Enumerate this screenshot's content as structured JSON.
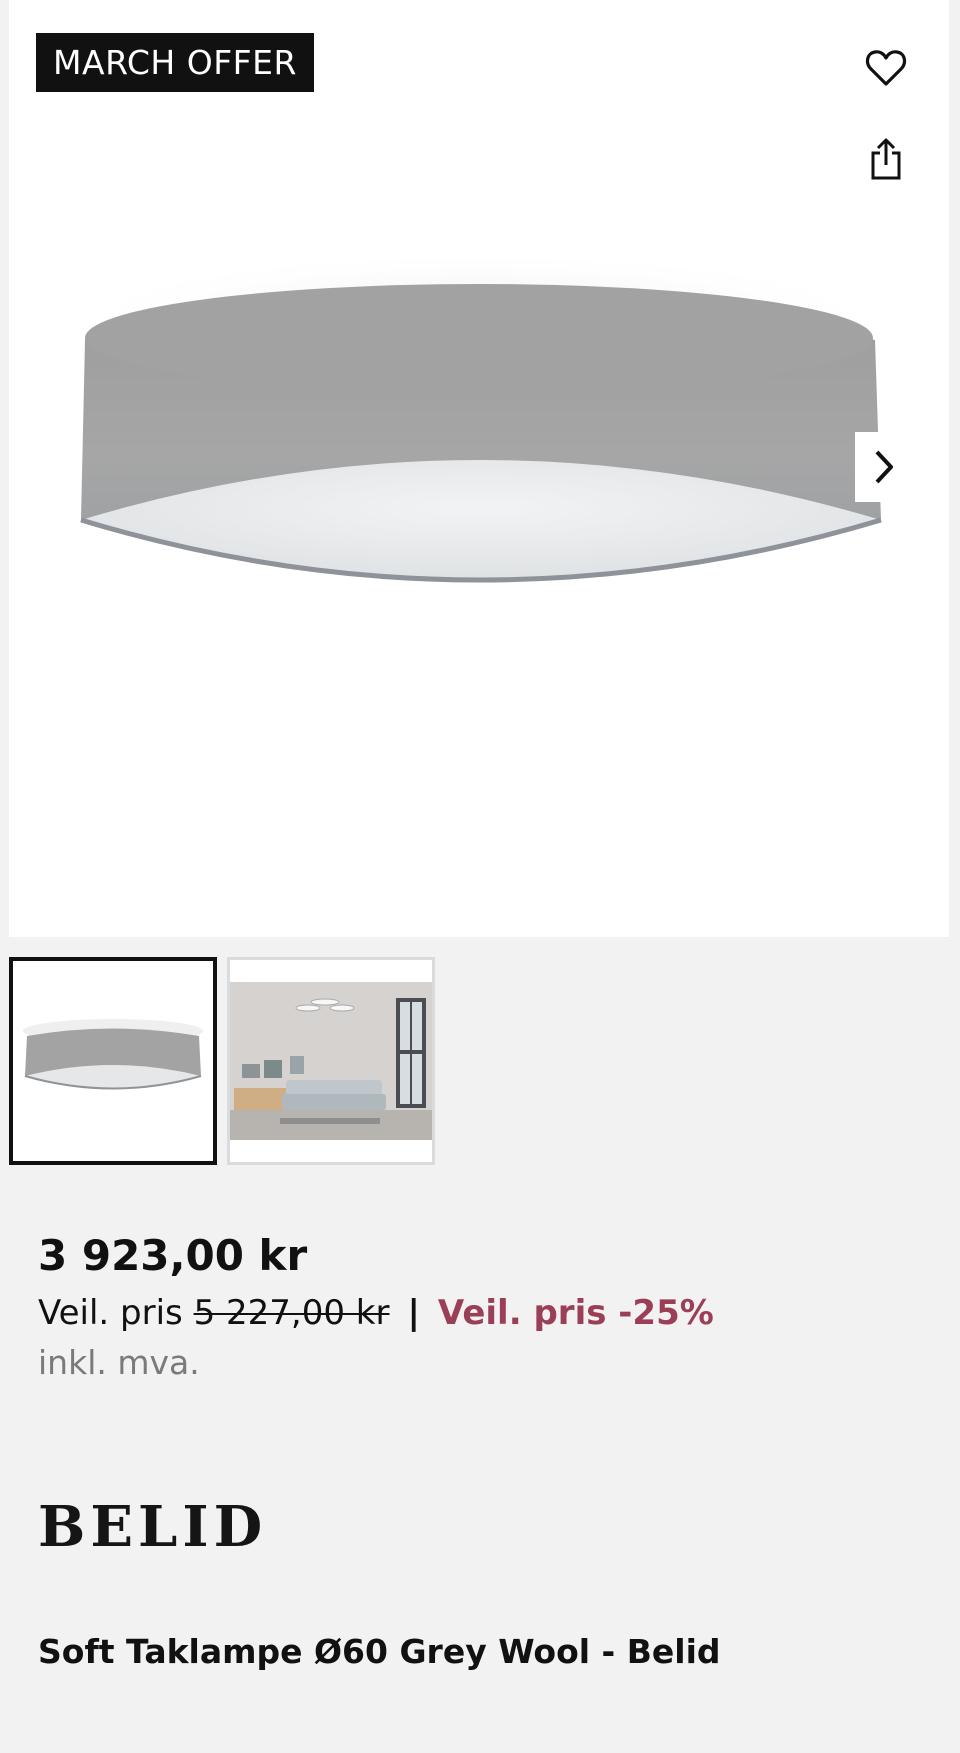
{
  "gallery": {
    "badge": "MARCH OFFER",
    "favorite_icon": "heart-icon",
    "share_icon": "share-icon",
    "next_icon": "chevron-right-icon",
    "thumbnails": [
      {
        "name": "ceiling-lamp-product-photo",
        "selected": true
      },
      {
        "name": "living-room-scene-photo",
        "selected": false
      }
    ]
  },
  "pricing": {
    "price": "3 923,00 kr",
    "recommended_label": "Veil. pris",
    "recommended_price": "5 227,00 kr",
    "separator": "|",
    "discount_label": "Veil. pris -25%",
    "vat_note": "inkl. mva."
  },
  "product": {
    "brand_logo_text": "BELID",
    "title": "Soft Taklampe Ø60 Grey Wool - Belid"
  },
  "colors": {
    "discount": "#9b3f56",
    "badge_bg": "#111111",
    "page_bg": "#f2f2f2",
    "thumb_selected_border": "#111111"
  }
}
